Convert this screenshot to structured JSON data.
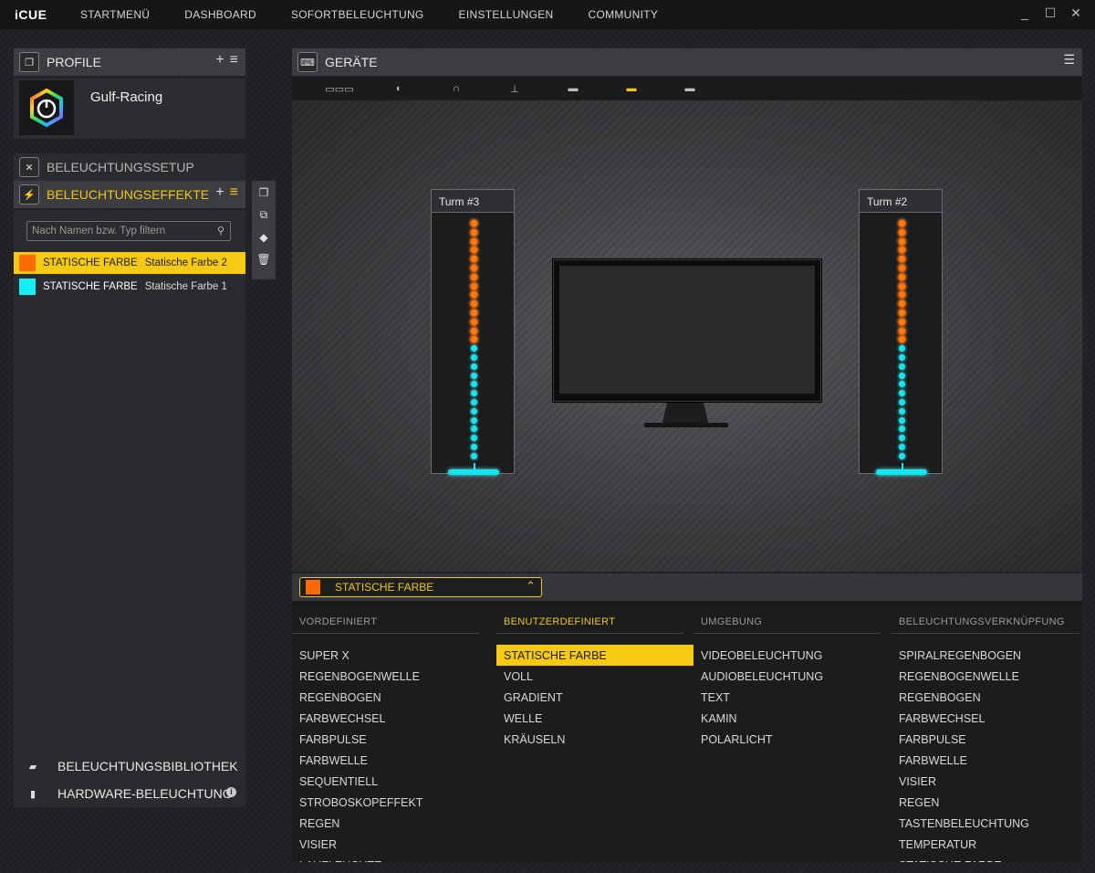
{
  "app": {
    "logo": "iCUE"
  },
  "nav": [
    "STARTMENÜ",
    "DASHBOARD",
    "SOFORTBELEUCHTUNG",
    "EINSTELLUNGEN",
    "COMMUNITY"
  ],
  "window_controls": {
    "minimize": "_",
    "maximize": "☐",
    "close": "✕"
  },
  "profiles": {
    "title": "PROFILE",
    "add": "+",
    "menu": "≡",
    "current": {
      "name": "Gulf-Racing",
      "icon": "icue-logo-icon"
    }
  },
  "lighting_setup": {
    "title": "BELEUCHTUNGSSETUP"
  },
  "lighting_effects": {
    "title": "BELEUCHTUNGSEFFEKTE",
    "add": "+",
    "menu": "≡",
    "filter_placeholder": "Nach Namen bzw. Typ filtern",
    "items": [
      {
        "type": "STATISCHE FARBE",
        "name": "Statische Farbe 2",
        "color": "#ff6a00",
        "selected": true
      },
      {
        "type": "STATISCHE FARBE",
        "name": "Statische Farbe 1",
        "color": "#12f0f5",
        "selected": false
      }
    ]
  },
  "lighting_library": {
    "title": "BELEUCHTUNGSBIBLIOTHEK"
  },
  "hardware_lighting": {
    "title": "HARDWARE-BELEUCHTUNG",
    "info": "i"
  },
  "devices": {
    "title": "GERÄTE",
    "device_icons": [
      "keyboard-icon",
      "mouse-icon",
      "headset-icon",
      "headset-stand-icon",
      "mousepad-icon",
      "fan-controller-icon",
      "ram-icon"
    ],
    "active_device_index": 5,
    "towers": [
      {
        "label": "Turm #3",
        "orange_leds": 14,
        "cyan_leds": 13
      },
      {
        "label": "Turm #2",
        "orange_leds": 14,
        "cyan_leds": 13
      }
    ]
  },
  "editor": {
    "current_effect": "STATISCHE FARBE",
    "current_color": "#ff6a00",
    "columns": [
      {
        "heading": "VORDEFINIERT",
        "active": false,
        "items": [
          "SUPER X",
          "REGENBOGENWELLE",
          "REGENBOGEN",
          "FARBWECHSEL",
          "FARBPULSE",
          "FARBWELLE",
          "SEQUENTIELL",
          "STROBOSKOPEFFEKT",
          "REGEN",
          "VISIER",
          "LAUFLEUCHTE"
        ]
      },
      {
        "heading": "BENUTZERDEFINIERT",
        "active": true,
        "selected_index": 0,
        "items": [
          "STATISCHE FARBE",
          "VOLL",
          "GRADIENT",
          "WELLE",
          "KRÄUSELN"
        ]
      },
      {
        "heading": "UMGEBUNG",
        "active": false,
        "items": [
          "VIDEOBELEUCHTUNG",
          "AUDIOBELEUCHTUNG",
          "TEXT",
          "KAMIN",
          "POLARLICHT"
        ]
      },
      {
        "heading": "BELEUCHTUNGSVERKNÜPFUNG",
        "active": false,
        "items": [
          "SPIRALREGENBOGEN",
          "REGENBOGENWELLE",
          "REGENBOGEN",
          "FARBWECHSEL",
          "FARBPULSE",
          "FARBWELLE",
          "VISIER",
          "REGEN",
          "TASTENBELEUCHTUNG",
          "TEMPERATUR",
          "STATISCHE FARBE"
        ]
      }
    ]
  },
  "colors": {
    "accent": "#f2c618",
    "orange": "#ff7a12",
    "cyan": "#14e4ee"
  }
}
